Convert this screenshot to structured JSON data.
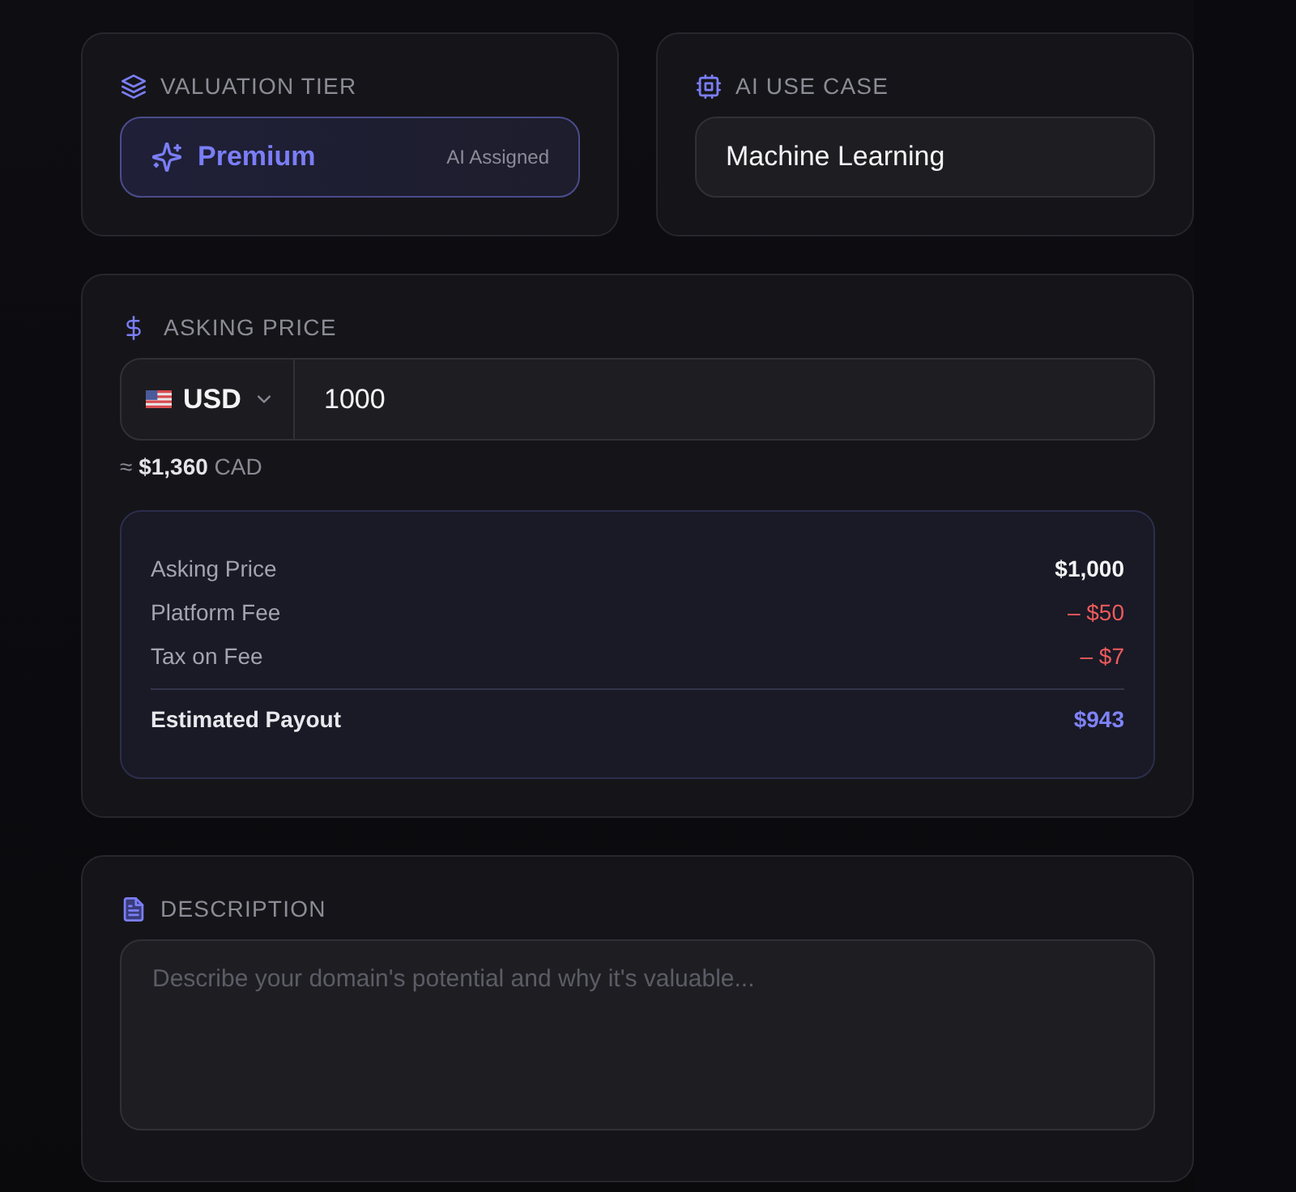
{
  "valuation_tier": {
    "label": "VALUATION TIER",
    "tier": "Premium",
    "badge": "AI Assigned"
  },
  "ai_use_case": {
    "label": "AI USE CASE",
    "value": "Machine Learning"
  },
  "asking_price": {
    "label": "ASKING PRICE",
    "currency": "USD",
    "value": "1000",
    "conversion": "≈ **$1,360** CAD",
    "breakdown": {
      "rows": [
        {
          "label": "Asking Price",
          "value": "$1,000",
          "kind": "base"
        },
        {
          "label": "Platform Fee",
          "value": "– $50",
          "kind": "deduction"
        },
        {
          "label": "Tax on Fee",
          "value": "– $7",
          "kind": "deduction"
        }
      ],
      "total": {
        "label": "Estimated Payout",
        "value": "$943"
      }
    }
  },
  "description": {
    "label": "DESCRIPTION",
    "placeholder": "Describe your domain's potential and why it's valuable..."
  }
}
